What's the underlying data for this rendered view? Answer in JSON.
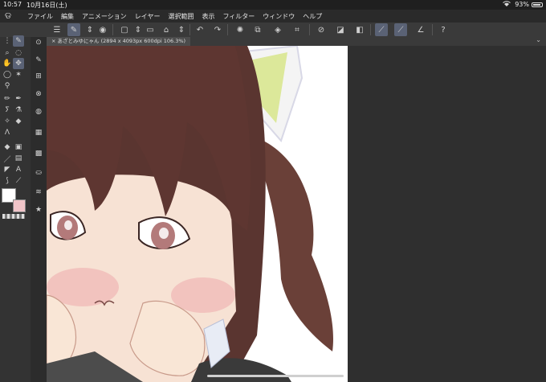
{
  "status_bar": {
    "time": "10:57",
    "date": "10月16日(土)",
    "battery": "93%"
  },
  "menubar": {
    "items": [
      "ファイル",
      "編集",
      "アニメーション",
      "レイヤー",
      "選択範囲",
      "表示",
      "フィルター",
      "ウィンドウ",
      "ヘルプ"
    ]
  },
  "document_tab": {
    "title": "× あざとみゆにゃん (2894 x 4093px 600dpi 106.3%)"
  },
  "colors": {
    "main_color": "#ffffff",
    "sub_color": "#f0c4c8",
    "selection_highlight": "#5a6275"
  }
}
